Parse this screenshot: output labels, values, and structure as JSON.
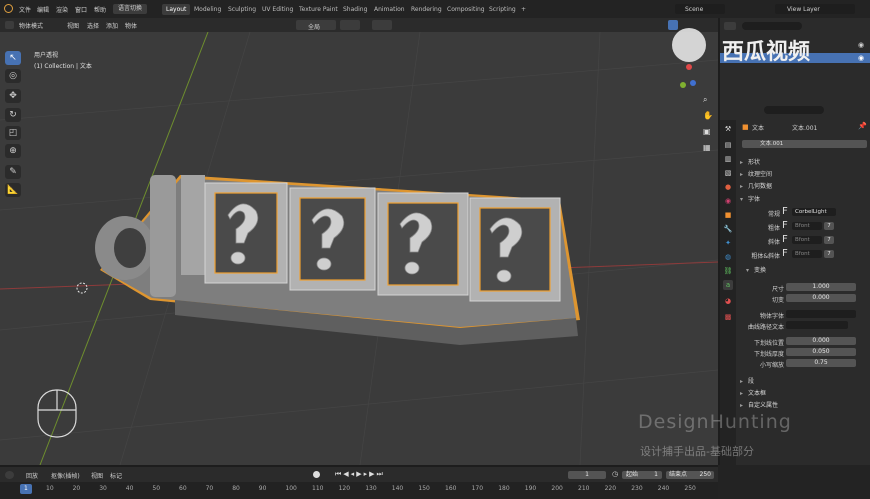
{
  "menu": [
    "文件",
    "编辑",
    "渲染",
    "窗口",
    "帮助"
  ],
  "mode_switch": "语言切换",
  "workspaces": [
    "Layout",
    "Modeling",
    "Sculpting",
    "UV Editing",
    "Texture Paint",
    "Shading",
    "Animation",
    "Rendering",
    "Compositing",
    "Scripting"
  ],
  "active_workspace": "Layout",
  "scene": "Scene",
  "view_layer": "View Layer",
  "viewport_header": {
    "mode": "物体模式",
    "view": "视图",
    "select": "选择",
    "add": "添加",
    "object": "物体",
    "orientation": "全局"
  },
  "viewport_info": {
    "line1": "用户透视",
    "line2": "(1) Collection | 文本"
  },
  "properties": {
    "breadcrumb_obj": "文本",
    "breadcrumb_data": "文本.001",
    "datablock": "文本.001",
    "sections": {
      "shape": "形状",
      "texture_space": "纹理空间",
      "geometry": "几何数据",
      "font": "字体",
      "transform": "变换",
      "paragraph": "段",
      "text_boxes": "文本框",
      "custom_props": "自定义属性"
    },
    "font_rows": [
      {
        "label": "常规",
        "value": "CorbelLight"
      },
      {
        "label": "粗体",
        "value": "Bfont",
        "num": "7"
      },
      {
        "label": "斜体",
        "value": "Bfont",
        "num": "7"
      },
      {
        "label": "粗体&斜体",
        "value": "Bfont",
        "num": "7"
      }
    ],
    "size_label": "尺寸",
    "size": "1.000",
    "shear_label": "切变",
    "shear": "0.000",
    "obj_font_label": "物体字体",
    "curve_path_label": "曲线路径文本",
    "underline_pos_label": "下划线位置",
    "underline_pos": "0.000",
    "underline_thick_label": "下划线厚度",
    "underline_thick": "0.050",
    "small_caps_label": "小写缩放",
    "small_caps": "0.75"
  },
  "timeline": {
    "playback": "回放",
    "keying": "抠像(插帧)",
    "view": "视图",
    "marker": "标记",
    "current_frame": "1",
    "start_label": "起始",
    "start": "1",
    "end_label": "结束点",
    "end": "250",
    "ticks": [
      "1",
      "10",
      "20",
      "30",
      "40",
      "50",
      "60",
      "70",
      "80",
      "90",
      "100",
      "110",
      "120",
      "130",
      "140",
      "150",
      "160",
      "170",
      "180",
      "190",
      "200",
      "210",
      "220",
      "230",
      "240",
      "250"
    ]
  },
  "watermark": {
    "brand": "西瓜视频",
    "line1": "DesignHunting",
    "line2": "设计捕手出品-基础部分"
  },
  "colors": {
    "accent": "#4772b3",
    "selection": "#f0a030",
    "ws_active": "#3c3c3c"
  }
}
